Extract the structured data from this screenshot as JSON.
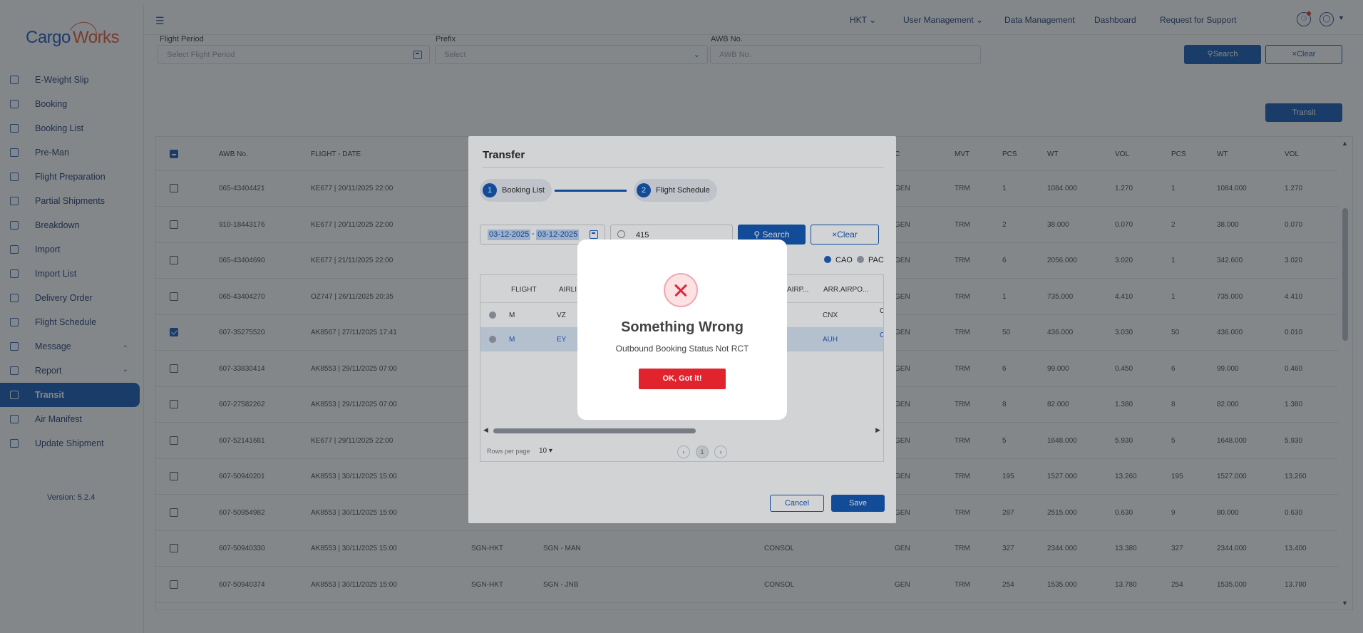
{
  "app": {
    "logo_part1": "Cargo",
    "logo_part2": "Works",
    "version": "Version: 5.2.4",
    "brand_color": "#0f57b5"
  },
  "sidebar": {
    "items": [
      {
        "label": "E-Weight Slip",
        "icon": "scale-icon"
      },
      {
        "label": "Booking",
        "icon": "booking-icon"
      },
      {
        "label": "Booking List",
        "icon": "list-icon"
      },
      {
        "label": "Pre-Man",
        "icon": "document-icon"
      },
      {
        "label": "Flight Preparation",
        "icon": "plane-icon"
      },
      {
        "label": "Partial Shipments",
        "icon": "package-icon"
      },
      {
        "label": "Breakdown",
        "icon": "breakdown-icon"
      },
      {
        "label": "Import",
        "icon": "import-icon"
      },
      {
        "label": "Import List",
        "icon": "list-icon"
      },
      {
        "label": "Delivery Order",
        "icon": "delivery-icon"
      },
      {
        "label": "Flight Schedule",
        "icon": "calendar-icon"
      },
      {
        "label": "Message",
        "icon": "send-icon"
      },
      {
        "label": "Report",
        "icon": "report-icon"
      },
      {
        "label": "Transit",
        "icon": "transit-icon"
      },
      {
        "label": "Air Manifest",
        "icon": "manifest-icon"
      },
      {
        "label": "Update Shipment",
        "icon": "box-icon"
      }
    ],
    "active": "Transit"
  },
  "header": {
    "nav": [
      "HKT",
      "User Management",
      "Data Management",
      "Dashboard",
      "Request for Support"
    ]
  },
  "filters": {
    "flight_period_label": "Flight Period",
    "flight_period_placeholder": "Select Flight Period",
    "prefix_label": "Prefix",
    "prefix_placeholder": "Select",
    "awb_label": "AWB No.",
    "awb_placeholder": "AWB No.",
    "search_label": "Search",
    "clear_label": "Clear",
    "transit_label": "Transit"
  },
  "table": {
    "headers": [
      "AWB No.",
      "FLIGHT - DATE",
      "C",
      "MVT",
      "PCS",
      "WT",
      "VOL",
      "PCS",
      "WT",
      "VOL"
    ],
    "rows": [
      {
        "awb": "065-43404421",
        "flight": "KE677 | 20/11/2025 22:00",
        "org": "",
        "route": "",
        "type": "",
        "shc": "GEN",
        "mvt": "TRM",
        "pcs": "1",
        "wt": "1084.000",
        "vol": "1.270",
        "pcs2": "1",
        "wt2": "1084.000",
        "vol2": "1.270",
        "checked": false
      },
      {
        "awb": "910-18443176",
        "flight": "KE677 | 20/11/2025 22:00",
        "org": "",
        "route": "",
        "type": "",
        "shc": "GEN",
        "mvt": "TRM",
        "pcs": "2",
        "wt": "38.000",
        "vol": "0.070",
        "pcs2": "2",
        "wt2": "38.000",
        "vol2": "0.070",
        "checked": false
      },
      {
        "awb": "065-43404690",
        "flight": "KE677 | 21/11/2025 22:00",
        "org": "",
        "route": "",
        "type": "",
        "shc": "GEN",
        "mvt": "TRM",
        "pcs": "6",
        "wt": "2056.000",
        "vol": "3.020",
        "pcs2": "1",
        "wt2": "342.600",
        "vol2": "3.020",
        "checked": false
      },
      {
        "awb": "065-43404270",
        "flight": "OZ747 | 26/11/2025 20:35",
        "org": "",
        "route": "",
        "type": "",
        "shc": "GEN",
        "mvt": "TRM",
        "pcs": "1",
        "wt": "735.000",
        "vol": "4.410",
        "pcs2": "1",
        "wt2": "735.000",
        "vol2": "4.410",
        "checked": false
      },
      {
        "awb": "607-35275520",
        "flight": "AK8567 | 27/11/2025 17:41",
        "org": "",
        "route": "",
        "type": "",
        "shc": "GEN",
        "mvt": "TRM",
        "pcs": "50",
        "wt": "436.000",
        "vol": "3.030",
        "pcs2": "50",
        "wt2": "436.000",
        "vol2": "0.010",
        "checked": true
      },
      {
        "awb": "607-33830414",
        "flight": "AK8553 | 29/11/2025 07:00",
        "org": "",
        "route": "",
        "type": "",
        "shc": "GEN",
        "mvt": "TRM",
        "pcs": "6",
        "wt": "99.000",
        "vol": "0.450",
        "pcs2": "6",
        "wt2": "99.000",
        "vol2": "0.460",
        "checked": false
      },
      {
        "awb": "607-27582262",
        "flight": "AK8553 | 29/11/2025 07:00",
        "org": "",
        "route": "",
        "type": "",
        "shc": "GEN",
        "mvt": "TRM",
        "pcs": "8",
        "wt": "82.000",
        "vol": "1.380",
        "pcs2": "8",
        "wt2": "82.000",
        "vol2": "1.380",
        "checked": false
      },
      {
        "awb": "607-52141681",
        "flight": "KE677 | 29/11/2025 22:00",
        "org": "",
        "route": "",
        "type": "",
        "shc": "GEN",
        "mvt": "TRM",
        "pcs": "5",
        "wt": "1648.000",
        "vol": "5.930",
        "pcs2": "5",
        "wt2": "1648.000",
        "vol2": "5.930",
        "checked": false
      },
      {
        "awb": "607-50940201",
        "flight": "AK8553 | 30/11/2025 15:00",
        "org": "",
        "route": "",
        "type": "",
        "shc": "GEN",
        "mvt": "TRM",
        "pcs": "195",
        "wt": "1527.000",
        "vol": "13.260",
        "pcs2": "195",
        "wt2": "1527.000",
        "vol2": "13.260",
        "checked": false
      },
      {
        "awb": "607-50954982",
        "flight": "AK8553 | 30/11/2025 15:00",
        "org": "",
        "route": "",
        "type": "",
        "shc": "GEN",
        "mvt": "TRM",
        "pcs": "287",
        "wt": "2515.000",
        "vol": "0.630",
        "pcs2": "9",
        "wt2": "80.000",
        "vol2": "0.630",
        "checked": false
      },
      {
        "awb": "607-50940330",
        "flight": "AK8553 | 30/11/2025 15:00",
        "org": "SGN-HKT",
        "route": "SGN - MAN",
        "type": "CONSOL",
        "shc": "GEN",
        "mvt": "TRM",
        "pcs": "327",
        "wt": "2344.000",
        "vol": "13.380",
        "pcs2": "327",
        "wt2": "2344.000",
        "vol2": "13.400",
        "checked": false
      },
      {
        "awb": "607-50940374",
        "flight": "AK8553 | 30/11/2025 15:00",
        "org": "SGN-HKT",
        "route": "SGN - JNB",
        "type": "CONSOL",
        "shc": "GEN",
        "mvt": "TRM",
        "pcs": "254",
        "wt": "1535.000",
        "vol": "13.780",
        "pcs2": "254",
        "wt2": "1535.000",
        "vol2": "13.780",
        "checked": false
      }
    ]
  },
  "transfer_modal": {
    "title": "Transfer",
    "steps": [
      {
        "num": "1",
        "label": "Booking List"
      },
      {
        "num": "2",
        "label": "Flight Schedule"
      }
    ],
    "date_from": "03-12-2025",
    "date_sep": "-",
    "date_to": "03-12-2025",
    "search_value": "415",
    "search_label": "Search",
    "clear_label": "Clear",
    "radio_cao": "CAO",
    "radio_pac": "PAC",
    "headers": [
      "FLIGHT",
      "AIRLI",
      "AIRP...",
      "ARR.AIRPO..."
    ],
    "rows": [
      {
        "flight": "M",
        "airline": "VZ",
        "arr": "CNX",
        "extra": "C",
        "highlight": false
      },
      {
        "flight": "M",
        "airline": "EY",
        "arr": "AUH",
        "extra": "C",
        "highlight": true
      }
    ],
    "rows_per_page_label": "Rows per page",
    "rows_per_page_value": "10",
    "page_current": "1",
    "cancel_label": "Cancel",
    "save_label": "Save"
  },
  "alert": {
    "title": "Something Wrong",
    "message": "Outbound Booking Status Not RCT",
    "button_label": "OK, Got it!",
    "accent_color": "#e0232d"
  }
}
